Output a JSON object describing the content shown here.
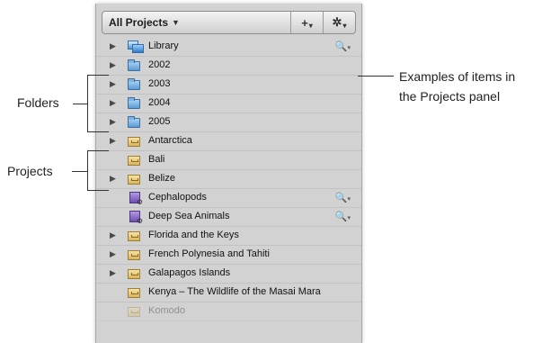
{
  "header": {
    "title": "All Projects",
    "add_label": "+",
    "action_label": "✲"
  },
  "rows": [
    {
      "label": "Library",
      "type": "library",
      "disclosure": true,
      "search": true
    },
    {
      "label": "2002",
      "type": "folder",
      "disclosure": true,
      "search": false
    },
    {
      "label": "2003",
      "type": "folder",
      "disclosure": true,
      "search": false
    },
    {
      "label": "2004",
      "type": "folder",
      "disclosure": true,
      "search": false
    },
    {
      "label": "2005",
      "type": "folder",
      "disclosure": true,
      "search": false
    },
    {
      "label": "Antarctica",
      "type": "project",
      "disclosure": true,
      "search": false
    },
    {
      "label": "Bali",
      "type": "project",
      "disclosure": false,
      "search": false
    },
    {
      "label": "Belize",
      "type": "project",
      "disclosure": true,
      "search": false
    },
    {
      "label": "Cephalopods",
      "type": "smart",
      "disclosure": false,
      "search": true
    },
    {
      "label": "Deep Sea Animals",
      "type": "smart",
      "disclosure": false,
      "search": true
    },
    {
      "label": "Florida and the Keys",
      "type": "project",
      "disclosure": true,
      "search": false
    },
    {
      "label": "French Polynesia and Tahiti",
      "type": "project",
      "disclosure": true,
      "search": false
    },
    {
      "label": "Galapagos Islands",
      "type": "project",
      "disclosure": true,
      "search": false
    },
    {
      "label": "Kenya – The Wildlife of the Masai Mara",
      "type": "project",
      "disclosure": false,
      "search": false
    },
    {
      "label": "Komodo",
      "type": "project",
      "disclosure": false,
      "search": false
    }
  ],
  "callouts": {
    "folders": "Folders",
    "projects": "Projects",
    "examples_line1": "Examples of items in",
    "examples_line2": "the Projects panel"
  }
}
